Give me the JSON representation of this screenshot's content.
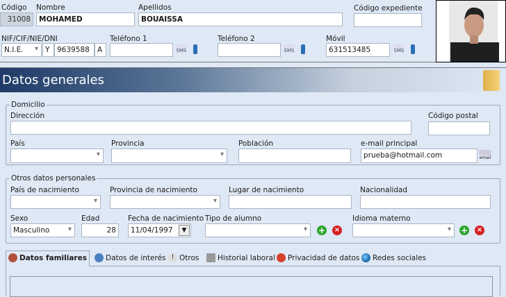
{
  "header": {
    "codigo": {
      "label": "Código",
      "value": "31008"
    },
    "nombre": {
      "label": "Nombre",
      "value": "MOHAMED"
    },
    "apellidos": {
      "label": "Apellidos",
      "value": "BOUAISSA"
    },
    "codigo_expediente": {
      "label": "Código expediente",
      "value": ""
    },
    "nif": {
      "label": "NIF/CIF/NIE/DNI",
      "type": "N.I.E.",
      "prefix": "Y",
      "number": "9639588",
      "letter": "A"
    },
    "telefono1": {
      "label": "Teléfono 1",
      "value": ""
    },
    "telefono2": {
      "label": "Teléfono 2",
      "value": ""
    },
    "movil": {
      "label": "Móvil",
      "value": "631513485"
    },
    "sms_label": "SMS"
  },
  "section": {
    "title": "Datos generales"
  },
  "domicilio": {
    "title": "Domicilio",
    "direccion": {
      "label": "Dirección",
      "value": ""
    },
    "codigo_postal": {
      "label": "Código postal",
      "value": ""
    },
    "pais": {
      "label": "País",
      "value": ""
    },
    "provincia": {
      "label": "Provincia",
      "value": ""
    },
    "poblacion": {
      "label": "Población",
      "value": ""
    },
    "email": {
      "label": "e-mail principal",
      "value": "prueba@hotmail.com",
      "icon_label": "email"
    }
  },
  "otros": {
    "title": "Otros datos personales",
    "pais_nac": {
      "label": "País de nacimiento",
      "value": ""
    },
    "prov_nac": {
      "label": "Provincia de nacimiento",
      "value": ""
    },
    "lugar_nac": {
      "label": "Lugar de nacimiento",
      "value": ""
    },
    "nacionalidad": {
      "label": "Nacionalidad",
      "value": ""
    },
    "sexo": {
      "label": "Sexo",
      "value": "Masculino"
    },
    "edad": {
      "label": "Edad",
      "value": "28"
    },
    "fecha_nac": {
      "label": "Fecha de nacimiento",
      "value": "11/04/1997"
    },
    "tipo_alumno": {
      "label": "Tipo de alumno",
      "value": ""
    },
    "idioma": {
      "label": "Idioma materno",
      "value": ""
    }
  },
  "tabs": [
    {
      "label": "Datos familiares",
      "active": true
    },
    {
      "label": "Datos de interés"
    },
    {
      "label": "Otros"
    },
    {
      "label": "Historial laboral"
    },
    {
      "label": "Privacidad de datos"
    },
    {
      "label": "Redes sociales"
    }
  ],
  "colors": {
    "background": "#dfe8f5",
    "header_band": "#1e3a66",
    "add": "#2aa52a",
    "remove": "#d42020"
  }
}
